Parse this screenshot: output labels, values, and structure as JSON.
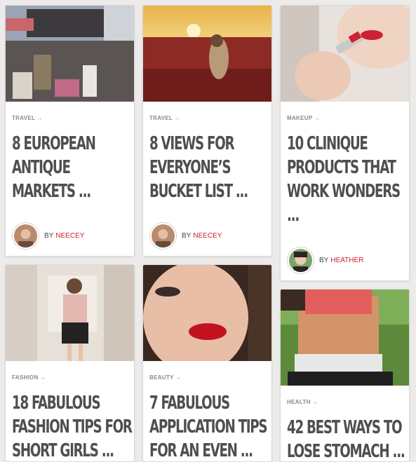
{
  "cards": [
    {
      "category": "TRAVEL →",
      "title": "8 EUROPEAN ANTIQUE MARKETS ...",
      "by": "BY",
      "author": "NEECEY"
    },
    {
      "category": "TRAVEL →",
      "title": "8 VIEWS FOR EVERYONE’S BUCKET LIST ...",
      "by": "BY",
      "author": "NEECEY"
    },
    {
      "category": "MAKEUP →",
      "title": "10 CLINIQUE PRODUCTS THAT WORK WONDERS ...",
      "by": "BY",
      "author": "HEATHER"
    },
    {
      "category": "FASHION →",
      "title": "18 FABULOUS FASHION TIPS FOR SHORT GIRLS ..."
    },
    {
      "category": "BEAUTY →",
      "title": "7 FABULOUS APPLICATION TIPS FOR AN EVEN ..."
    },
    {
      "category": "HEALTH →",
      "title": "42 BEST WAYS TO LOSE STOMACH ..."
    }
  ],
  "colors": {
    "accent": "#d0202a",
    "background": "#ecebe9",
    "title": "#4f4f4f"
  }
}
